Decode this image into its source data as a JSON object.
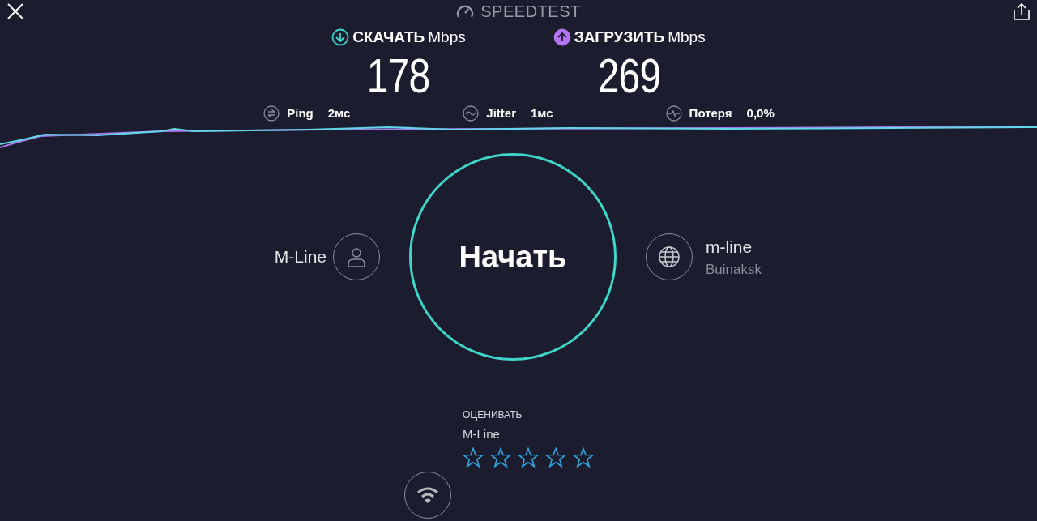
{
  "header": {
    "title": "SPEEDTEST"
  },
  "metrics": [
    {
      "kind": "download",
      "label": "СКАЧАТЬ",
      "unit": "Mbps",
      "value": "178"
    },
    {
      "kind": "upload",
      "label": "ЗАГРУЗИТЬ",
      "unit": "Mbps",
      "value": "269"
    }
  ],
  "stats": [
    {
      "kind": "ping",
      "label": "Ping",
      "value": "2мс"
    },
    {
      "kind": "jitter",
      "label": "Jitter",
      "value": "1мс"
    },
    {
      "kind": "loss",
      "label": "Потеря",
      "value": "0,0%"
    }
  ],
  "provider": {
    "name": "M-Line"
  },
  "start_button": {
    "label": "Начать"
  },
  "server": {
    "name": "m-line",
    "location": "Buinaksk"
  },
  "rating": {
    "title": "ОЦЕНИВАТЬ",
    "provider": "M-Line",
    "stars": 0
  }
}
